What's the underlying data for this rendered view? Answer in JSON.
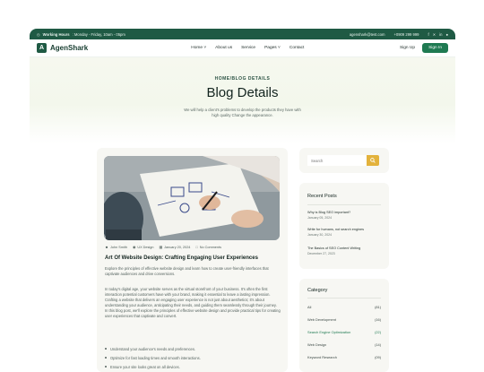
{
  "topbar": {
    "working_hours": "Working Hours",
    "schedule": " : Monday - Friday, 10am - 05pm",
    "email": "agenshark@test.com",
    "phone": "+0909 299 999",
    "social": [
      "f",
      "✕",
      "in",
      "●"
    ]
  },
  "nav": {
    "brand": "AgenShark",
    "logo_letter": "A",
    "items": [
      {
        "label": "Home ˅"
      },
      {
        "label": "About us"
      },
      {
        "label": "Service"
      },
      {
        "label": "Pages ˅"
      },
      {
        "label": "Contact"
      }
    ],
    "signup": "Sign Up",
    "signin": "Sign In"
  },
  "hero": {
    "breadcrumb": "HOME/BLOG DETAILS",
    "title": "Blog Details",
    "subtitle": "We will help a client's problems to develop the products they have with high quality Change the appearance."
  },
  "post": {
    "author": "John Smith",
    "category": "UX Design",
    "date": "January 20, 2024",
    "comments": "No Comments",
    "title": "Art Of Website Design: Crafting Engaging User Experiences",
    "intro": "Explore the principles of effective website design and learn how to create user-friendly interfaces that captivate audiences and drive conversions.",
    "body": "In today's digital age, your website serves as the virtual storefront of your business. It's often the first interaction potential customers have with your brand, making it essential to leave a lasting impression. Crafting a website that delivers an engaging user experience is not just about aesthetics; it's about understanding your audience, anticipating their needs, and guiding them seamlessly through their journey. In this blog post, we'll explore the principles of effective website design and provide practical tips for creating user experiences that captivate and convert.",
    "bullets": [
      "Understand your audience's needs and preferences.",
      "Optimize for fast loading times and smooth interactions.",
      "Ensure your site looks great on all devices."
    ]
  },
  "search": {
    "placeholder": "Search"
  },
  "recent": {
    "heading": "Recent Posts",
    "posts": [
      {
        "title": "Why is Blog SEO important?",
        "date": "January 05, 2024"
      },
      {
        "title": "Write for humans, not search engines",
        "date": "January 30, 2024"
      },
      {
        "title": "The Basics of SEO Content Writing",
        "date": "December 27, 2023"
      }
    ]
  },
  "category": {
    "heading": "Category",
    "items": [
      {
        "name": "All",
        "count": "(81)"
      },
      {
        "name": "Web Development",
        "count": "(16)"
      },
      {
        "name": "Search Engine Optimization",
        "count": "(22)"
      },
      {
        "name": "Web Design",
        "count": "(14)"
      },
      {
        "name": "Keyword Research",
        "count": "(09)"
      }
    ]
  },
  "colors": {
    "brand": "#1f5a44",
    "accent": "#1f7a52",
    "search_button": "#e3b23c"
  }
}
